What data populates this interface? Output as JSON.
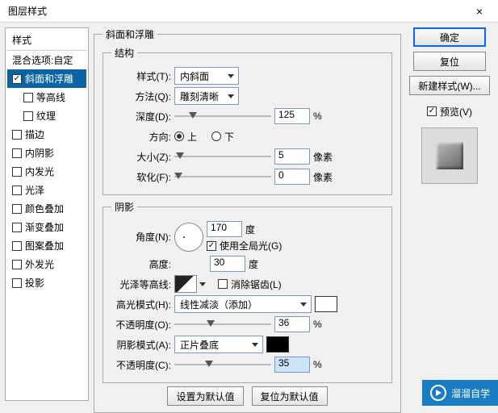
{
  "window": {
    "title": "图层样式",
    "close": "×"
  },
  "sidebar": {
    "header": "样式",
    "blend": "混合选项:自定",
    "items": [
      {
        "label": "斜面和浮雕",
        "checked": true,
        "active": true
      },
      {
        "label": "等高线",
        "checked": false,
        "nested": true
      },
      {
        "label": "纹理",
        "checked": false,
        "nested": true
      },
      {
        "label": "描边",
        "checked": false
      },
      {
        "label": "内阴影",
        "checked": false
      },
      {
        "label": "内发光",
        "checked": false
      },
      {
        "label": "光泽",
        "checked": false
      },
      {
        "label": "颜色叠加",
        "checked": false
      },
      {
        "label": "渐变叠加",
        "checked": false
      },
      {
        "label": "图案叠加",
        "checked": false
      },
      {
        "label": "外发光",
        "checked": false
      },
      {
        "label": "投影",
        "checked": false
      }
    ]
  },
  "panel": {
    "group_title": "斜面和浮雕",
    "struct_title": "结构",
    "style_lbl": "样式(T):",
    "style_val": "内斜面",
    "method_lbl": "方法(Q):",
    "method_val": "雕刻清晰",
    "depth_lbl": "深度(D):",
    "depth_val": "125",
    "pct": "%",
    "dir_lbl": "方向:",
    "up": "上",
    "down": "下",
    "size_lbl": "大小(Z):",
    "size_val": "5",
    "px": "像素",
    "soften_lbl": "软化(F):",
    "soften_val": "0",
    "shade_title": "阴影",
    "angle_lbl": "角度(N):",
    "angle_val": "170",
    "deg": "度",
    "global_lbl": "使用全局光(G)",
    "alt_lbl": "高度:",
    "alt_val": "30",
    "contour_lbl": "光泽等高线:",
    "anti_lbl": "消除锯齿(L)",
    "hl_mode_lbl": "高光模式(H):",
    "hl_mode_val": "线性减淡（添加）",
    "hl_op_lbl": "不透明度(O):",
    "hl_op_val": "36",
    "sh_mode_lbl": "阴影模式(A):",
    "sh_mode_val": "正片叠底",
    "sh_op_lbl": "不透明度(C):",
    "sh_op_val": "35",
    "set_default": "设置为默认值",
    "reset_default": "复位为默认值"
  },
  "right": {
    "ok": "确定",
    "cancel": "复位",
    "newstyle": "新建样式(W)...",
    "preview_lbl": "预览(V)"
  },
  "watermark": "溜溜自学"
}
